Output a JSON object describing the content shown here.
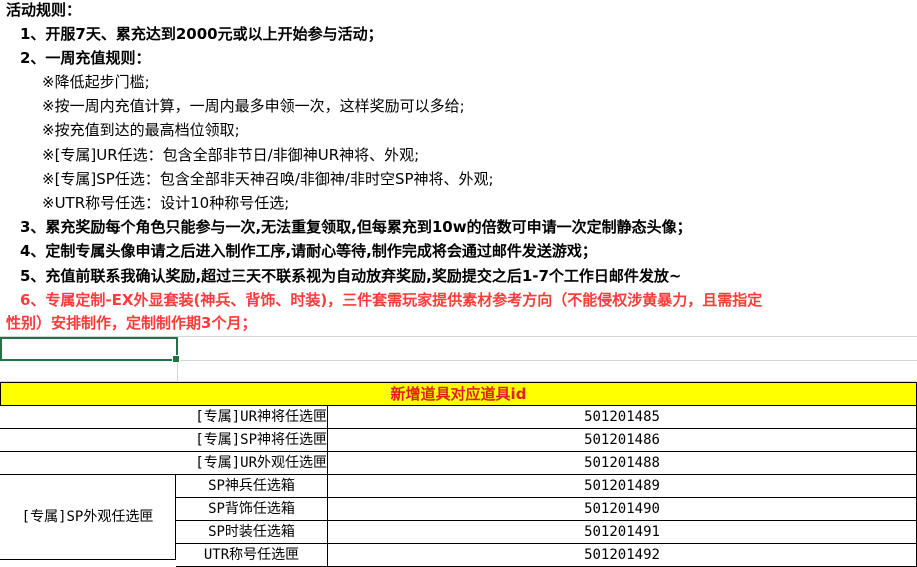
{
  "rules": {
    "title": "活动规则：",
    "items": [
      "1、开服7天、累充达到2000元或以上开始参与活动；",
      "2、一周充值规则：",
      "※降低起步门槛;",
      "※按一周内充值计算，一周内最多申领一次，这样奖励可以多给;",
      "※按充值到达的最高档位领取;",
      "※[专属]UR任选：包含全部非节日/非御神UR神将、外观;",
      "※[专属]SP任选：包含全部非天神召唤/非御神/非时空SP神将、外观;",
      "※UTR称号任选：设计10种称号任选;",
      "3、累充奖励每个角色只能参与一次,无法重复领取,但每累充到10w的倍数可申请一次定制静态头像；",
      "4、定制专属头像申请之后进入制作工序,请耐心等待,制作完成将会通过邮件发送游戏；",
      "5、充值前联系我确认奖励,超过三天不联系视为自动放弃奖励,奖励提交之后1-7个工作日邮件发放~",
      "6、专属定制-EX外显套装(神兵、背饰、时装)，三件套需玩家提供素材参考方向（不能侵权涉黄暴力，且需指定",
      "性别）安排制作，定制制作期3个月；"
    ]
  },
  "table": {
    "header": "新增道具对应道具id",
    "rows": [
      {
        "name": "[专属]UR神将任选匣",
        "id": "501201485"
      },
      {
        "name": "[专属]SP神将任选匣",
        "id": "501201486"
      },
      {
        "name": "[专属]UR外观任选匣",
        "id": "501201488"
      }
    ],
    "group": {
      "name": "[专属]SP外观任选匣",
      "rows": [
        {
          "name": "SP神兵任选箱",
          "id": "501201489"
        },
        {
          "name": "SP背饰任选箱",
          "id": "501201490"
        },
        {
          "name": "SP时装任选箱",
          "id": "501201491"
        },
        {
          "name": "UTR称号任选匣",
          "id": "501201492"
        }
      ]
    }
  }
}
